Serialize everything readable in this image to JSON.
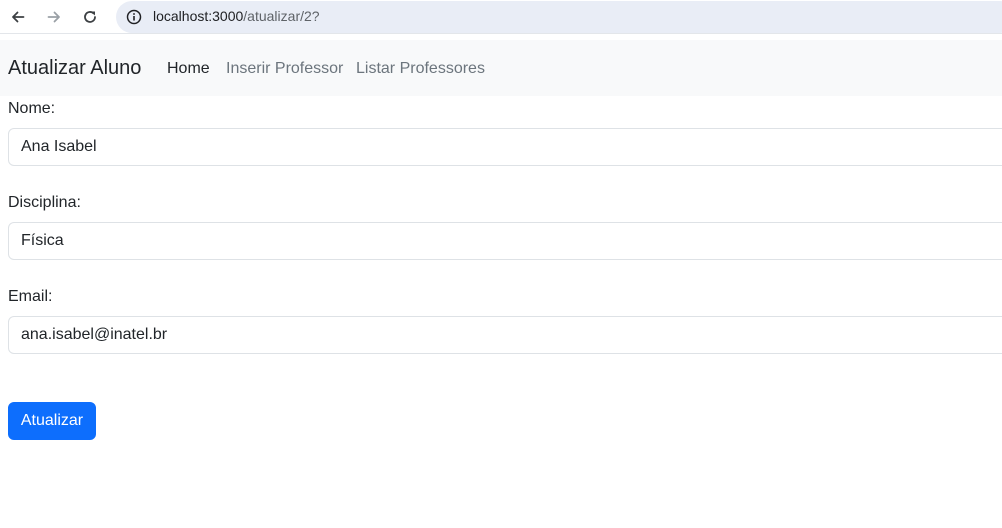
{
  "browser": {
    "url_host": "localhost:3000",
    "url_path": "/atualizar/2?",
    "back_icon": "arrow-left-icon",
    "forward_icon": "arrow-right-icon",
    "reload_icon": "reload-icon",
    "info_icon": "info-icon"
  },
  "navbar": {
    "brand": "Atualizar Aluno",
    "links": [
      {
        "label": "Home",
        "active": true
      },
      {
        "label": "Inserir Professor",
        "active": false
      },
      {
        "label": "Listar Professores",
        "active": false
      }
    ]
  },
  "form": {
    "nome_label": "Nome:",
    "nome_value": "Ana Isabel",
    "disciplina_label": "Disciplina:",
    "disciplina_value": "Física",
    "email_label": "Email:",
    "email_value": "ana.isabel@inatel.br",
    "submit_label": "Atualizar"
  },
  "colors": {
    "primary": "#0d6efd",
    "navbar_bg": "#f8f9fa",
    "url_bar_bg": "#e9edf6"
  }
}
